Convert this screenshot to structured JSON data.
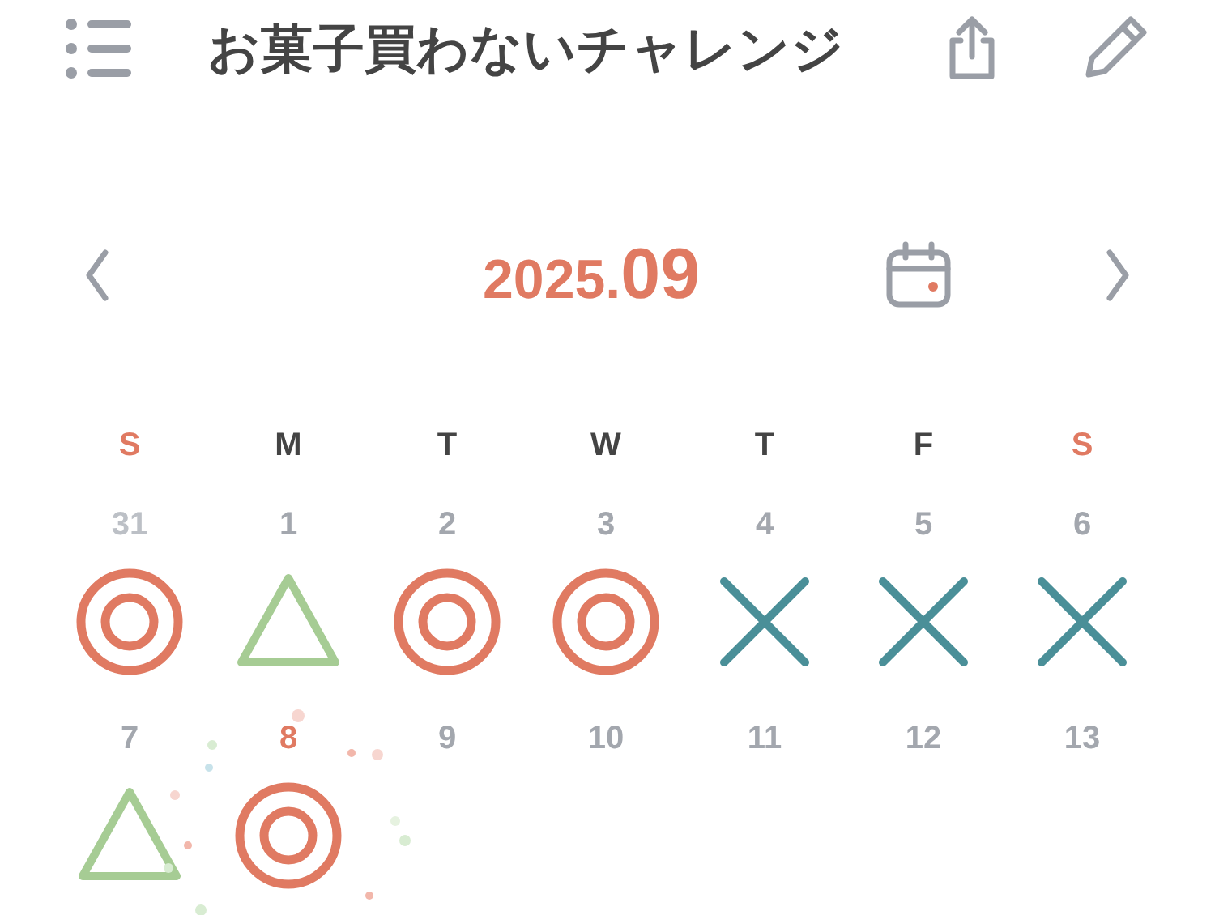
{
  "header": {
    "title": "お菓子買わないチャレンジ"
  },
  "month": {
    "year": "2025.",
    "month": "09"
  },
  "weekdays": [
    {
      "label": "S",
      "kind": "weekend"
    },
    {
      "label": "M",
      "kind": "weekday"
    },
    {
      "label": "T",
      "kind": "weekday"
    },
    {
      "label": "W",
      "kind": "weekday"
    },
    {
      "label": "T",
      "kind": "weekday"
    },
    {
      "label": "F",
      "kind": "weekday"
    },
    {
      "label": "S",
      "kind": "weekend"
    }
  ],
  "weeks": [
    [
      {
        "day": "31",
        "other_month": true,
        "today": false,
        "kind": "double_circle"
      },
      {
        "day": "1",
        "other_month": false,
        "today": false,
        "kind": "triangle"
      },
      {
        "day": "2",
        "other_month": false,
        "today": false,
        "kind": "double_circle"
      },
      {
        "day": "3",
        "other_month": false,
        "today": false,
        "kind": "double_circle"
      },
      {
        "day": "4",
        "other_month": false,
        "today": false,
        "kind": "cross"
      },
      {
        "day": "5",
        "other_month": false,
        "today": false,
        "kind": "cross"
      },
      {
        "day": "6",
        "other_month": false,
        "today": false,
        "kind": "cross"
      }
    ],
    [
      {
        "day": "7",
        "other_month": false,
        "today": false,
        "kind": "triangle"
      },
      {
        "day": "8",
        "other_month": false,
        "today": true,
        "kind": "double_circle"
      },
      {
        "day": "9",
        "other_month": false,
        "today": false,
        "kind": "plain"
      },
      {
        "day": "10",
        "other_month": false,
        "today": false,
        "kind": "plain"
      },
      {
        "day": "11",
        "other_month": false,
        "today": false,
        "kind": "plain"
      },
      {
        "day": "12",
        "other_month": false,
        "today": false,
        "kind": "plain"
      },
      {
        "day": "13",
        "other_month": false,
        "today": false,
        "kind": "plain"
      }
    ]
  ]
}
